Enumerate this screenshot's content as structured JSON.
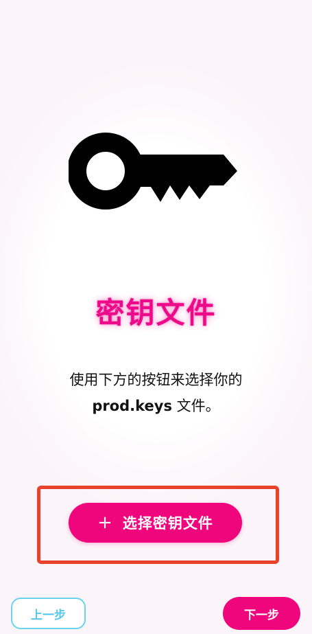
{
  "page": {
    "title": "密钥文件",
    "description_line1": "使用下方的按钮来选择你的",
    "description_filename": "prod.keys",
    "description_suffix": " 文件。"
  },
  "actions": {
    "select_plus": "+",
    "select_label": "选择密钥文件",
    "prev_label": "上一步",
    "next_label": "下一步"
  },
  "icons": {
    "hero": "key-icon",
    "select": "plus-icon"
  },
  "colors": {
    "accent": "#f0067c",
    "title": "#ec0a8a",
    "highlight_frame": "#e8412c",
    "secondary_outline": "#6ad3ef"
  }
}
